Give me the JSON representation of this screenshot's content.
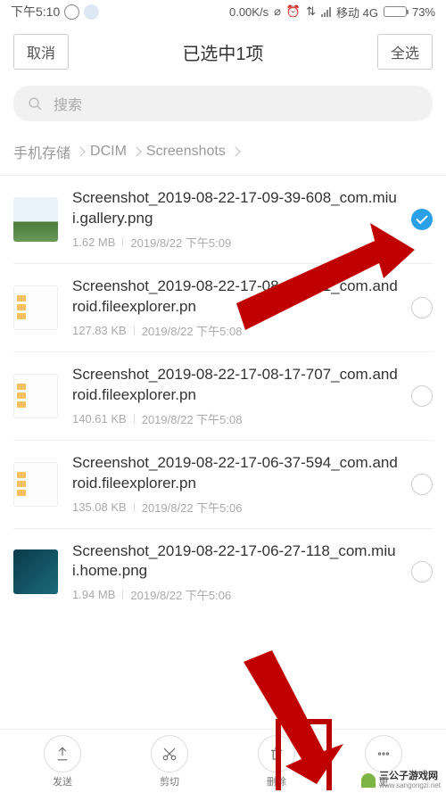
{
  "status": {
    "time": "下午5:10",
    "net_speed": "0.00K/s",
    "carrier": "移动 4G",
    "battery": "73%"
  },
  "header": {
    "cancel": "取消",
    "title": "已选中1项",
    "select_all": "全选"
  },
  "search": {
    "placeholder": "搜索"
  },
  "breadcrumb": {
    "items": [
      "手机存储",
      "DCIM",
      "Screenshots"
    ]
  },
  "files": [
    {
      "thumb": "gallery",
      "name": "Screenshot_2019-08-22-17-09-39-608_com.miui.gallery.png",
      "size": "1.62 MB",
      "date": "2019/8/22 下午5:09",
      "checked": true
    },
    {
      "thumb": "explorer",
      "name": "Screenshot_2019-08-22-17-08-22-421_com.android.fileexplorer.pn",
      "size": "127.83 KB",
      "date": "2019/8/22 下午5:08",
      "checked": false
    },
    {
      "thumb": "explorer",
      "name": "Screenshot_2019-08-22-17-08-17-707_com.android.fileexplorer.pn",
      "size": "140.61 KB",
      "date": "2019/8/22 下午5:08",
      "checked": false
    },
    {
      "thumb": "explorer",
      "name": "Screenshot_2019-08-22-17-06-37-594_com.android.fileexplorer.pn",
      "size": "135.08 KB",
      "date": "2019/8/22 下午5:06",
      "checked": false
    },
    {
      "thumb": "home",
      "name": "Screenshot_2019-08-22-17-06-27-118_com.miui.home.png",
      "size": "1.94 MB",
      "date": "2019/8/22 下午5:06",
      "checked": false
    }
  ],
  "actions": {
    "send": "发送",
    "cut": "剪切",
    "delete": "删除",
    "more": "更"
  },
  "watermark": {
    "title": "三公子游戏网",
    "url": "www.sangongzi.net"
  }
}
